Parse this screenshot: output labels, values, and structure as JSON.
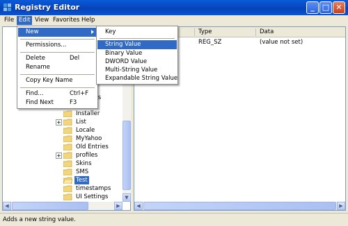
{
  "window": {
    "title": "Registry Editor"
  },
  "menubar": {
    "file": "File",
    "edit": "Edit",
    "view": "View",
    "favorites": "Favorites",
    "help": "Help"
  },
  "edit_menu": {
    "new": "New",
    "permissions": "Permissions...",
    "delete": "Delete",
    "delete_key": "Del",
    "rename": "Rename",
    "copy_key_name": "Copy Key Name",
    "find": "Find...",
    "find_key": "Ctrl+F",
    "find_next": "Find Next",
    "find_next_key": "F3"
  },
  "new_submenu": {
    "key": "Key",
    "string_value": "String Value",
    "binary_value": "Binary Value",
    "dword_value": "DWORD Value",
    "multi_string_value": "Multi-String Value",
    "expandable_string_value": "Expandable String Value"
  },
  "tree": {
    "partial_1": "er",
    "partial_2": "ttings",
    "partial_3": "ents",
    "items": [
      "Installer",
      "List",
      "Locale",
      "MyYahoo",
      "Old Entries",
      "profiles",
      "Skins",
      "SMS",
      "Test",
      "timestamps",
      "UI Settings"
    ]
  },
  "list": {
    "headers": {
      "type": "Type",
      "data": "Data"
    },
    "rows": [
      {
        "type": "REG_SZ",
        "data": "(value not set)"
      }
    ]
  },
  "status": {
    "text": "Adds a new string value."
  },
  "colors": {
    "titlebar": "#0a5bd6",
    "highlight": "#316ac5",
    "window_bg": "#ece9d8"
  }
}
